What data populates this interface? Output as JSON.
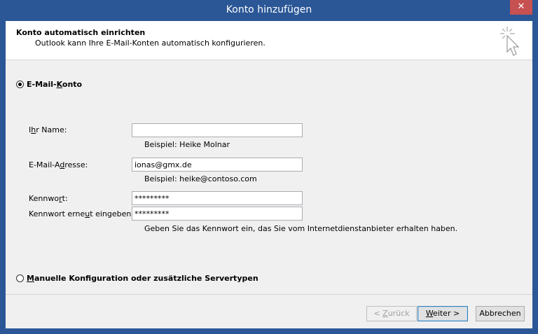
{
  "window": {
    "title": "Konto hinzufügen",
    "close_symbol": "✕"
  },
  "header": {
    "title": "Konto automatisch einrichten",
    "subtitle": "Outlook kann Ihre E-Mail-Konten automatisch konfigurieren.",
    "icon": "wizard-cursor-icon"
  },
  "options": {
    "email_account": {
      "pre": "E-Mail-",
      "accel": "K",
      "post": "onto",
      "selected": true
    },
    "manual": {
      "pre": "",
      "accel": "M",
      "post": "anuelle Konfiguration oder zusätzliche Servertypen",
      "selected": false
    }
  },
  "form": {
    "name": {
      "label_pre": "I",
      "label_accel": "h",
      "label_post": "r Name:",
      "value": "",
      "hint": "Beispiel: Heike Molnar"
    },
    "email": {
      "label_pre": "E-Mail-A",
      "label_accel": "d",
      "label_post": "resse:",
      "value": "ionas@gmx.de",
      "hint": "Beispiel: heike@contoso.com"
    },
    "password": {
      "label_pre": "Kennwo",
      "label_accel": "r",
      "label_post": "t:",
      "value": "*********"
    },
    "password_repeat": {
      "label_pre": "Kennwort erne",
      "label_accel": "u",
      "label_post": "t eingeben:",
      "value": "*********"
    },
    "password_hint": "Geben Sie das Kennwort ein, das Sie vom Internetdienstanbieter erhalten haben."
  },
  "buttons": {
    "back": {
      "pre": "< ",
      "accel": "Z",
      "post": "urück",
      "enabled": false
    },
    "next": {
      "pre": "",
      "accel": "W",
      "post": "eiter >",
      "enabled": true
    },
    "cancel": {
      "label": "Abbrechen",
      "enabled": true
    }
  }
}
